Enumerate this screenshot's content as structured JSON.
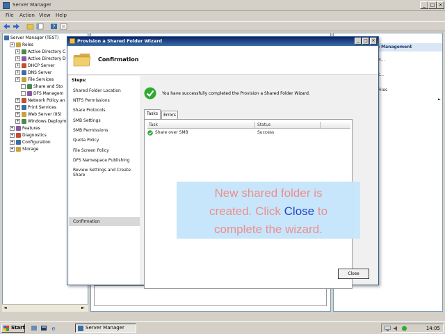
{
  "server_manager": {
    "title": "Server Manager",
    "menu": [
      "File",
      "Action",
      "View",
      "Help"
    ],
    "tree": [
      {
        "label": "Server Manager (TEST)",
        "level": 0
      },
      {
        "label": "Roles",
        "level": 1
      },
      {
        "label": "Active Directory C",
        "level": 2
      },
      {
        "label": "Active Directory D",
        "level": 2
      },
      {
        "label": "DHCP Server",
        "level": 2
      },
      {
        "label": "DNS Server",
        "level": 2
      },
      {
        "label": "File Services",
        "level": 2
      },
      {
        "label": "Share and Sto",
        "level": 3
      },
      {
        "label": "DFS Managem",
        "level": 3
      },
      {
        "label": "Network Policy an",
        "level": 2
      },
      {
        "label": "Print Services",
        "level": 2
      },
      {
        "label": "Web Server (IIS)",
        "level": 2
      },
      {
        "label": "Windows Deploym",
        "level": 2
      },
      {
        "label": "Features",
        "level": 1
      },
      {
        "label": "Diagnostics",
        "level": 1
      },
      {
        "label": "Configuration",
        "level": 1
      },
      {
        "label": "Storage",
        "level": 1
      }
    ],
    "actions_header": "e Management",
    "actions": [
      "e...",
      "t...",
      "Files",
      ""
    ]
  },
  "wizard": {
    "title": "Provision a Shared Folder Wizard",
    "page_title": "Confirmation",
    "steps_header": "Steps:",
    "steps": [
      "Shared Folder Location",
      "NTFS Permissions",
      "Share Protocols",
      "SMB Settings",
      "SMB Permissions",
      "Quota Policy",
      "File Screen Policy",
      "DFS Namespace Publishing",
      "Review Settings and Create Share",
      "Confirmation"
    ],
    "current_step_index": 9,
    "success_message": "You have successfully completed the Provision a Shared Folder Wizard.",
    "tabs": [
      "Tasks",
      "Errors"
    ],
    "list_columns": [
      "Task",
      "Status"
    ],
    "tasks": [
      {
        "task": "Share over SMB",
        "status": "Success"
      }
    ],
    "close_label": "Close"
  },
  "callout": {
    "line1": "New shared folder is",
    "line2_pre": "created. Click ",
    "line2_hl": "Close",
    "line2_post": " to",
    "line3": "complete the wizard."
  },
  "taskbar": {
    "start_label": "Start",
    "task_label": "Server Manager",
    "clock": "14:05"
  },
  "colors": {
    "wizard_title_bar": "#0a246a",
    "callout_bg": "#c6e6fb",
    "callout_text": "#f08a8a",
    "callout_highlight": "#1b3fc6",
    "success_green": "#2eaa2e"
  },
  "icons": [
    "folder-icon",
    "success-check-icon",
    "start-flag-icon",
    "minimize-icon",
    "maximize-icon",
    "close-icon"
  ]
}
